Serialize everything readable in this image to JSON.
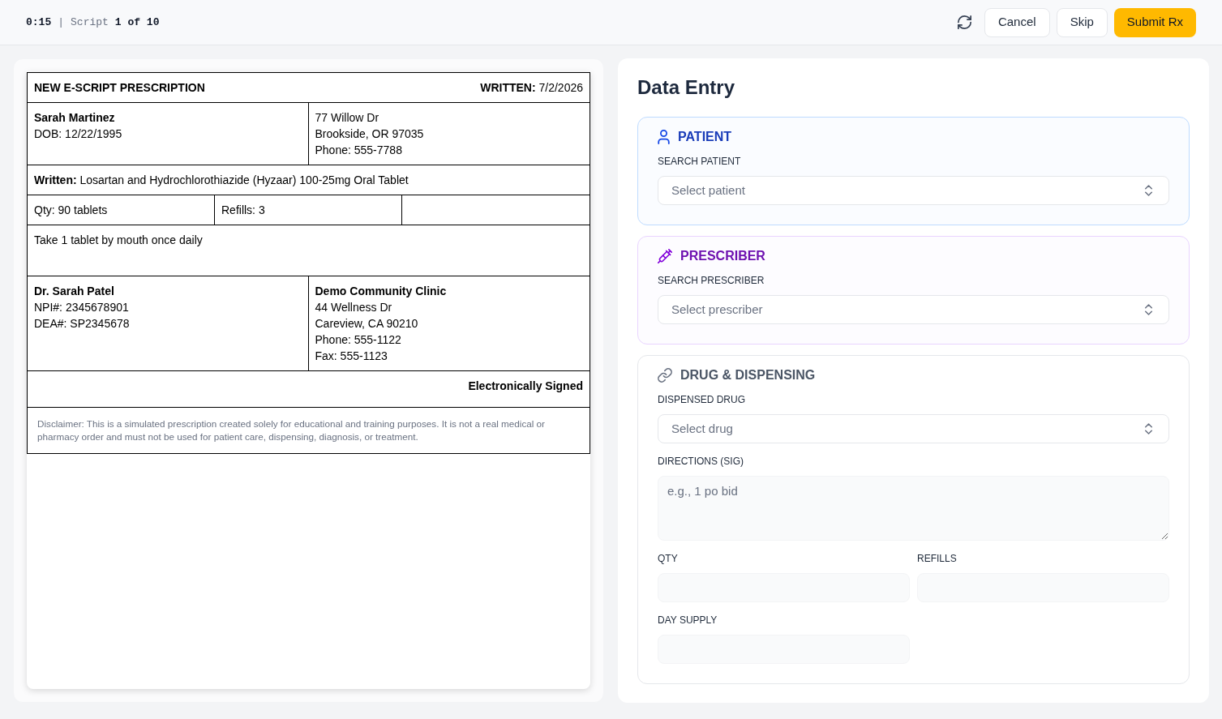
{
  "top_bar": {
    "timer": "0:15",
    "separator": "|",
    "script_label": "Script",
    "script_position": "1 of 10",
    "buttons": [
      {
        "kind": "cancel",
        "label": "Cancel"
      },
      {
        "kind": "skip",
        "label": "Skip"
      },
      {
        "kind": "submit",
        "label": "Submit Rx"
      }
    ]
  },
  "prescription": {
    "title": "NEW E-SCRIPT PRESCRIPTION",
    "written_date": "**WRITTEN:** 7/2/2026",
    "patient": {
      "name": "Sarah Martinez",
      "dob": "DOB: 12/22/1995",
      "address_lines": [
        "77 Willow Dr",
        "Brookside, OR 97035",
        "Phone: 555-7788"
      ]
    },
    "written_drug": "**Written:** Losartan and Hydrochlorothiazide (Hyzaar) 100-25mg Oral Tablet",
    "quantity": "Qty: 90 tablets",
    "refills": "Refills: 3",
    "directions": "Take 1 tablet by mouth once daily",
    "prescriber": {
      "name": "Dr. Sarah Patel",
      "details": [
        "NPI#: 2345678901",
        "DEA#: SP2345678"
      ]
    },
    "clinic": {
      "name": "Demo Community Clinic",
      "details": [
        "44 Wellness Dr",
        "Careview, CA 90210",
        "Phone: 555-1122",
        "Fax: 555-1123"
      ]
    },
    "signature": "Electronically Signed",
    "disclaimer": "Disclaimer: This is a simulated prescription created solely for educational and training purposes. It is not a real medical or pharmacy order and must not be used for patient care, dispensing, diagnosis, or treatment."
  },
  "data_entry": {
    "title": "Data Entry",
    "sections": [
      {
        "kind": "patient",
        "title": "PATIENT",
        "fields": [
          {
            "kind": "select",
            "label": "SEARCH PATIENT",
            "placeholder": "Select patient"
          }
        ]
      },
      {
        "kind": "prescriber",
        "title": "PRESCRIBER",
        "fields": [
          {
            "kind": "select",
            "label": "SEARCH PRESCRIBER",
            "placeholder": "Select prescriber"
          }
        ]
      },
      {
        "kind": "drug",
        "title": "DRUG & DISPENSING",
        "fields": [
          {
            "kind": "select",
            "label": "DISPENSED DRUG",
            "placeholder": "Select drug"
          },
          {
            "kind": "textarea",
            "label": "DIRECTIONS (SIG)",
            "placeholder": "e.g., 1 po bid"
          },
          {
            "kind": "input",
            "label": "QTY"
          },
          {
            "kind": "input",
            "label": "REFILLS"
          },
          {
            "kind": "input",
            "label": "DAY SUPPLY"
          }
        ]
      }
    ]
  }
}
